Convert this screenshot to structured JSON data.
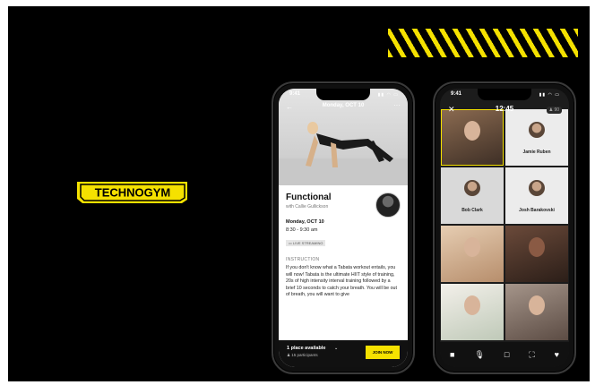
{
  "brand": {
    "logo_text": "TECHNOGYM",
    "accent": "#f5e100"
  },
  "class_screen": {
    "status_time": "9:41",
    "header_date": "Monday, OCT 10",
    "class_title": "Functional",
    "instructor": "with Callie Gullickson",
    "date": "Monday, OCT 10",
    "time": "8:30 - 9:30 am",
    "badge": "LIVE STREAMING",
    "section_label": "INSTRUCTION",
    "instruction": "If you don't know what a Tabata workout entails, you will now! Tabata is the ultimate HIIT style of training, 20s of high intensity interval training followed by a brief 10 seconds to catch your breath. You will be out of breath, you will want to give",
    "availability": "1 place available",
    "participants": "15 participants",
    "join_label": "JOIN NOW"
  },
  "call_screen": {
    "status_time": "9:41",
    "clock": "12:45",
    "participant_count": "90",
    "tiles": [
      {
        "name": "Jamie Ruben"
      },
      {
        "name": "Bob Clark"
      },
      {
        "name": "Josh Barakovski"
      }
    ],
    "controls": [
      "camera-icon",
      "mic-icon",
      "screen-icon",
      "fullscreen-icon",
      "heart-icon"
    ]
  }
}
